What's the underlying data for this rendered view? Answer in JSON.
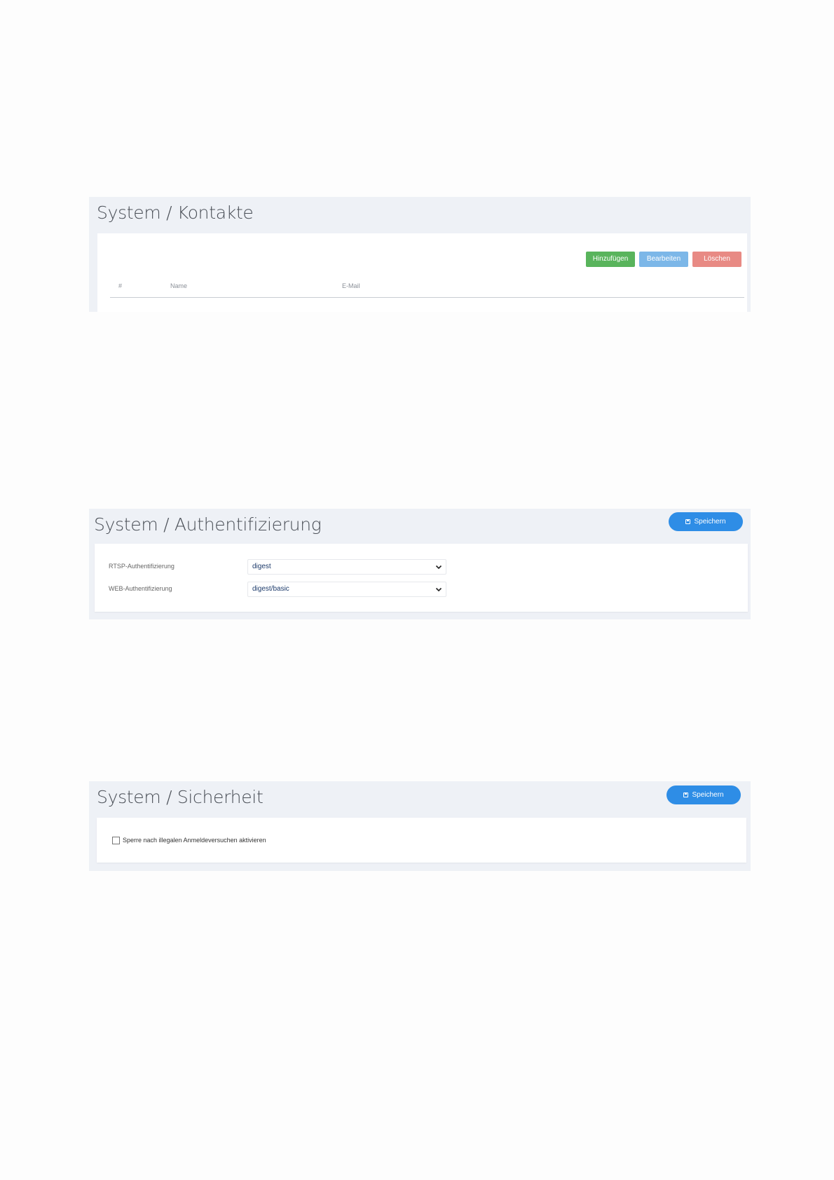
{
  "kontakte": {
    "title": "System / Kontakte",
    "buttons": {
      "add": "Hinzufügen",
      "edit": "Bearbeiten",
      "delete": "Löschen"
    },
    "columns": [
      "#",
      "Name",
      "E-Mail"
    ],
    "colors": {
      "add": "#59b45c",
      "edit": "#7cb7e8",
      "delete": "#e88a84"
    }
  },
  "auth": {
    "title": "System / Authentifizierung",
    "save_label": "Speichern",
    "rtsp_label": "RTSP-Authentifizierung",
    "rtsp_value": "digest",
    "web_label": "WEB-Authentifizierung",
    "web_value": "digest/basic"
  },
  "security": {
    "title": "System / Sicherheit",
    "save_label": "Speichern",
    "lock_label": "Sperre nach illegalen Anmeldeversuchen aktivieren",
    "lock_checked": false
  },
  "icons": [
    "save-icon",
    "chevron-down-icon",
    "checkbox"
  ]
}
